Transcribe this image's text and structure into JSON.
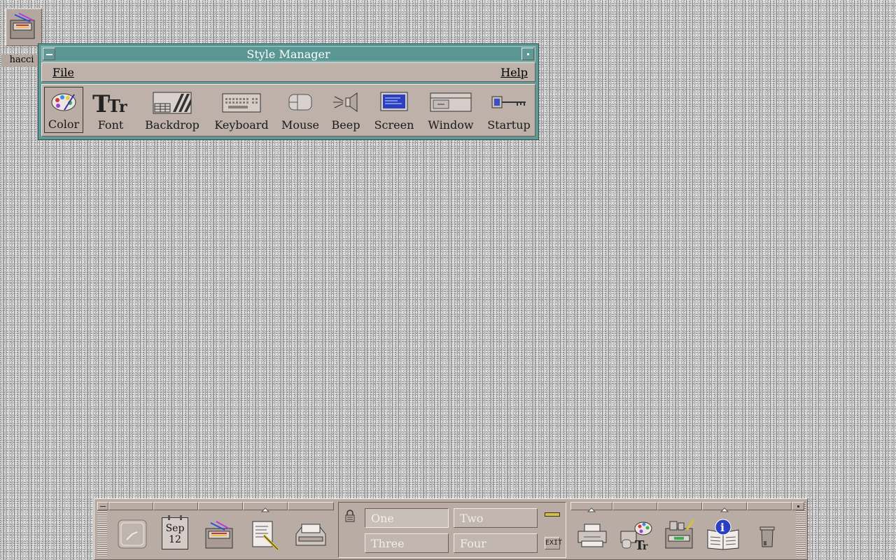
{
  "desktop_icon": {
    "label": "hacci"
  },
  "window": {
    "title": "Style Manager",
    "menu": {
      "file": "File",
      "help": "Help"
    },
    "tools": [
      {
        "label": "Color",
        "icon": "palette-icon"
      },
      {
        "label": "Font",
        "icon": "font-icon"
      },
      {
        "label": "Backdrop",
        "icon": "backdrop-icon"
      },
      {
        "label": "Keyboard",
        "icon": "keyboard-icon"
      },
      {
        "label": "Mouse",
        "icon": "mouse-icon"
      },
      {
        "label": "Beep",
        "icon": "speaker-icon"
      },
      {
        "label": "Screen",
        "icon": "screen-icon"
      },
      {
        "label": "Window",
        "icon": "window-icon"
      },
      {
        "label": "Startup",
        "icon": "key-icon"
      }
    ]
  },
  "panel": {
    "calendar": {
      "month": "Sep",
      "day": "12"
    },
    "workspaces": [
      "One",
      "Two",
      "Three",
      "Four"
    ],
    "exit_label": "EXIT",
    "colors": {
      "title_bar": "#5a9794",
      "panel": "#b8aca5",
      "window_body": "#bdb1aa"
    }
  }
}
